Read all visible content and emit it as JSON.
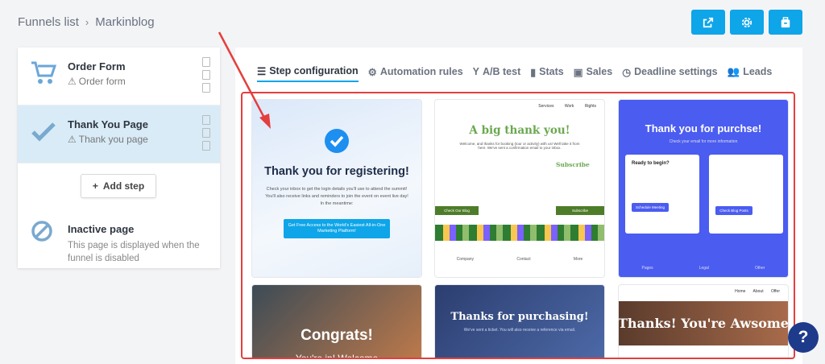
{
  "breadcrumb": {
    "root": "Funnels list",
    "current": "Markinblog"
  },
  "steps": [
    {
      "title": "Order Form",
      "subtitle": "Order form"
    },
    {
      "title": "Thank You Page",
      "subtitle": "Thank you page"
    }
  ],
  "add_step": "Add step",
  "inactive": {
    "title": "Inactive page",
    "description": "This page is displayed when the funnel is disabled"
  },
  "tabs": [
    "Step configuration",
    "Automation rules",
    "A/B test",
    "Stats",
    "Sales",
    "Deadline settings",
    "Leads"
  ],
  "templates": {
    "t1": {
      "heading": "Thank you for registering!",
      "text": "Check your inbox to get the login details you'll use to attend the summit! You'll also receive links and reminders to join the event on event live day! In the meantime:",
      "cta": "Get Free Access to the World's Easiest All-in-One Marketing Platform!"
    },
    "t2": {
      "nav": "Services Work Rights",
      "heading": "A big thank you!",
      "text": "Welcome, and thanks for booking (tour or activity) with us! Well take it from here. We've sent a confirmation email to your inbox.",
      "subscribe": "Subscribe",
      "btn_left": "Check Our Blog",
      "btn_right": "Subscribe",
      "foot": [
        "Company",
        "Contact",
        "More"
      ]
    },
    "t3": {
      "heading": "Thank you for purchse!",
      "text": "Check your email for more information",
      "box1_title": "Ready to begin?",
      "box1_btn": "Schedule Meeting",
      "box2_btn": "Check Blog Posts",
      "foot": [
        "Pages",
        "Legal",
        "Other"
      ]
    },
    "t4": {
      "heading": "Congrats!",
      "sub": "You're in! Welcome"
    },
    "t5": {
      "heading": "Thanks for purchasing!",
      "text": "We've sent a ticket. You will also receive a reference via email."
    },
    "t6": {
      "nav": "Home About Offer",
      "heading": "Thanks! You're Awsome"
    }
  },
  "help_label": "?",
  "colors": {
    "accent": "#0ea5e9",
    "highlight_border": "#e53e3e",
    "active_step_bg": "#d8ebf7"
  }
}
